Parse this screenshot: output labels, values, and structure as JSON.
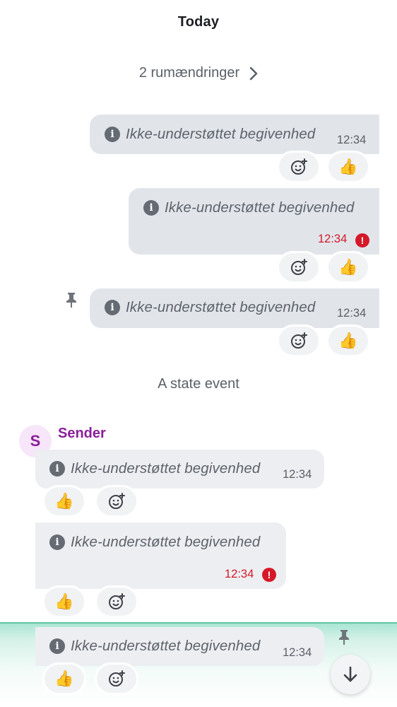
{
  "timeline": {
    "date_separator": "Today",
    "room_changes": "2 rumændringer",
    "state_event": "A state event",
    "sender": {
      "name": "Sender",
      "initial": "S"
    }
  },
  "messages": [
    {
      "text": "Ikke-understøttet begivenhed",
      "time": "12:34",
      "error": false,
      "reactions": [
        "add-reaction",
        "👍"
      ]
    },
    {
      "text": "Ikke-understøttet begivenhed",
      "time": "12:34",
      "error": true,
      "reactions": [
        "add-reaction",
        "👍"
      ]
    },
    {
      "text": "Ikke-understøttet begivenhed",
      "time": "12:34",
      "error": false,
      "pinned": true,
      "reactions": [
        "add-reaction",
        "👍"
      ]
    },
    {
      "text": "Ikke-understøttet begivenhed",
      "time": "12:34",
      "error": false,
      "reactions": [
        "👍",
        "add-reaction"
      ]
    },
    {
      "text": "Ikke-understøttet begivenhed",
      "time": "12:34",
      "error": true,
      "reactions": [
        "👍",
        "add-reaction"
      ]
    },
    {
      "text": "Ikke-understøttet begivenhed",
      "time": "12:34",
      "error": false,
      "pinned": true,
      "highlighted": true,
      "reactions": [
        "👍",
        "add-reaction"
      ]
    }
  ],
  "icons": {
    "info": "info-icon",
    "error": "error-icon",
    "pin": "pin-icon",
    "add_reaction": "add-reaction-icon",
    "chevron": "chevron-right-icon",
    "scroll_down": "arrow-down-icon"
  },
  "colors": {
    "outgoing_bubble": "#e1e5ea",
    "incoming_bubble": "#eceef1",
    "error": "#d51928",
    "sender": "#8a1f9a",
    "highlight": "#5fc5a4"
  }
}
